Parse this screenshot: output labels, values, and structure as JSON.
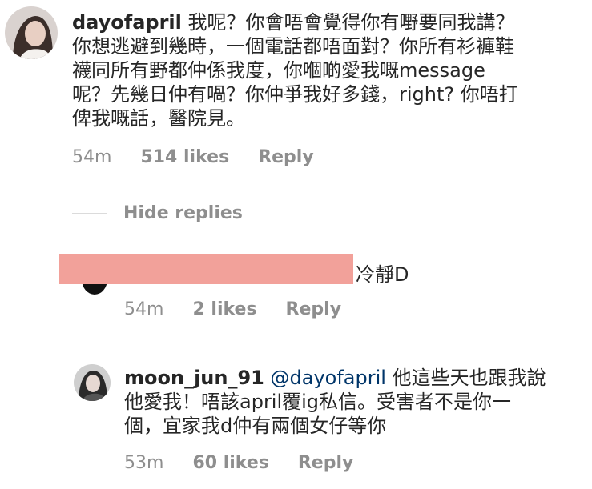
{
  "comments": [
    {
      "username": "dayofapril",
      "text": " 我呢？你會唔會覺得你有嘢要同我講？\n你想逃避到幾時，一個電話都唔面對？你所有衫褲鞋\n襪同所有野都仲係我度，你嗰啲愛我嘅message\n呢？先幾日仲有喎？你仲爭我好多錢，right? 你唔打\n俾我嘅話，醫院見。",
      "time": "54m",
      "likes": "514 likes",
      "reply": "Reply"
    },
    {
      "username": "",
      "text": "冷靜D",
      "time": "54m",
      "likes": "2 likes",
      "reply": "Reply"
    },
    {
      "username": "moon_jun_91",
      "mention": "@dayofapril",
      "text": " 他這些天也跟我說\n他愛我！唔該april覆ig私信。受害者不是你一\n個，宜家我d仲有兩個女仔等你",
      "time": "53m",
      "likes": "60 likes",
      "reply": "Reply"
    }
  ],
  "hide_replies": "Hide replies",
  "colors": {
    "text": "#262626",
    "meta": "#8e8e8e",
    "mention": "#003569",
    "redaction": "#f2a19a"
  }
}
